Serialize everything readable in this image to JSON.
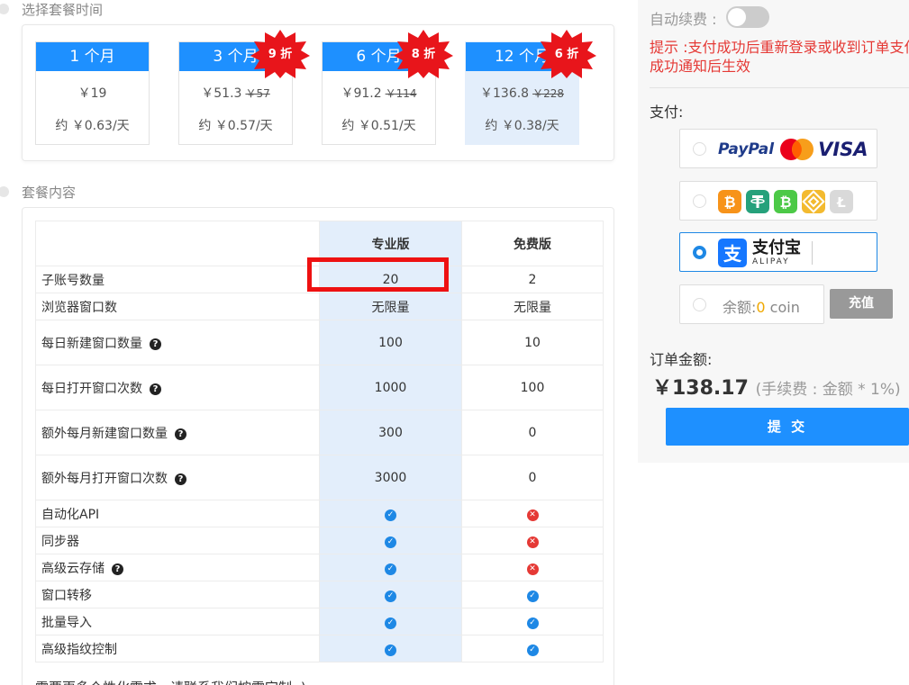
{
  "plans": {
    "title": "选择套餐时间",
    "items": [
      {
        "label": "1 个月",
        "price": "￥19",
        "original": "",
        "per_day": "约 ￥0.63/天",
        "discount": ""
      },
      {
        "label": "3 个月",
        "price": "￥51.3",
        "original": "￥57",
        "per_day": "约 ￥0.57/天",
        "discount": "9 折"
      },
      {
        "label": "6 个月",
        "price": "￥91.2",
        "original": "￥114",
        "per_day": "约 ￥0.51/天",
        "discount": "8 折"
      },
      {
        "label": "12 个月",
        "price": "￥136.8",
        "original": "￥228",
        "per_day": "约 ￥0.38/天",
        "discount": "6 折"
      }
    ],
    "selected_index": 3
  },
  "features": {
    "title": "套餐内容",
    "col_pro": "专业版",
    "col_free": "免费版",
    "rows": [
      {
        "name": "子账号数量",
        "pro": "20",
        "free": "2",
        "help": false
      },
      {
        "name": "浏览器窗口数",
        "pro": "无限量",
        "free": "无限量",
        "help": false
      },
      {
        "name": "每日新建窗口数量",
        "pro": "100",
        "free": "10",
        "help": true
      },
      {
        "name": "每日打开窗口次数",
        "pro": "1000",
        "free": "100",
        "help": true
      },
      {
        "name": "额外每月新建窗口数量",
        "pro": "300",
        "free": "0",
        "help": true
      },
      {
        "name": "额外每月打开窗口次数",
        "pro": "3000",
        "free": "0",
        "help": true
      },
      {
        "name": "自动化API",
        "pro": "check",
        "free": "cross",
        "help": false
      },
      {
        "name": "同步器",
        "pro": "check",
        "free": "cross",
        "help": false
      },
      {
        "name": "高级云存储",
        "pro": "check",
        "free": "cross",
        "help": true
      },
      {
        "name": "窗口转移",
        "pro": "check",
        "free": "check",
        "help": false
      },
      {
        "name": "批量导入",
        "pro": "check",
        "free": "check",
        "help": false
      },
      {
        "name": "高级指纹控制",
        "pro": "check",
        "free": "check",
        "help": false
      }
    ],
    "note": "需要更多个性化需求，请联系我们按需定制 :)"
  },
  "payment": {
    "auto_renew_label": "自动续费 :",
    "tip_label": "提示 :",
    "tip_text": "支付成功后重新登录或收到订单支付成功通知后生效",
    "pay_label": "支付:",
    "paypal_text": "PayPal",
    "visa_text": "VISA",
    "alipay_text": "支付宝",
    "alipay_sub": "ALIPAY",
    "balance_label": "余额:",
    "balance_value": "0",
    "balance_unit": " coin",
    "recharge_label": "充值",
    "order_label": "订单金额:",
    "order_amount": "￥138.17",
    "order_fee": "(手续费 : 金额 * 1%)",
    "submit_label": "提 交",
    "selected_method": "alipay"
  },
  "colors": {
    "accent": "#1e90ff",
    "highlight_box": "#ee1111",
    "discount_badge": "#e8151b",
    "tip": "#e53935"
  }
}
